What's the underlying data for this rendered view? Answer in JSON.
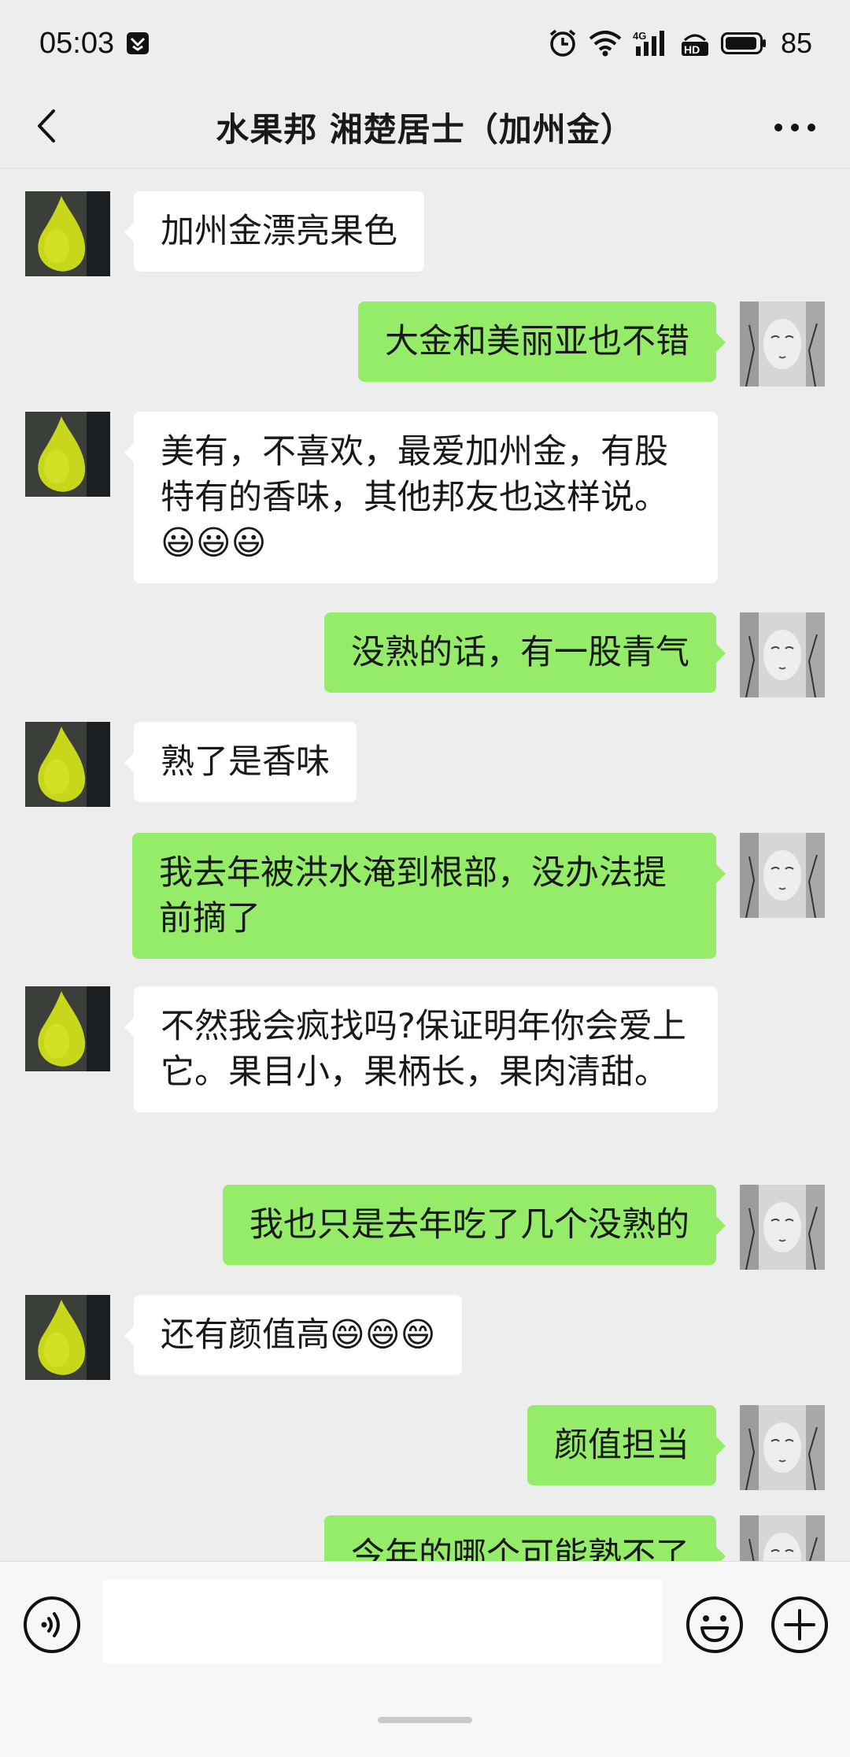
{
  "status_bar": {
    "time": "05:03",
    "battery": "85",
    "icons": [
      "app-notification-icon",
      "alarm-icon",
      "wifi-icon",
      "4g-signal-icon",
      "hd-icon",
      "battery-icon"
    ]
  },
  "header": {
    "title": "水果邦  湘楚居士（加州金）",
    "back_icon": "chevron-left-icon",
    "more_icon": "more-dots-icon"
  },
  "messages": [
    {
      "side": "left",
      "text": "加州金漂亮果色"
    },
    {
      "side": "right",
      "text": "大金和美丽亚也不错"
    },
    {
      "side": "left",
      "text": "美有，不喜欢，最爱加州金，有股特有的香味，其他邦友也这样说。😃😃😃"
    },
    {
      "side": "right",
      "text": "没熟的话，有一股青气"
    },
    {
      "side": "left",
      "text": "熟了是香味"
    },
    {
      "side": "right",
      "text": "我去年被洪水淹到根部，没办法提前摘了"
    },
    {
      "side": "left",
      "text": "不然我会疯找吗?保证明年你会爱上它。果目小，果柄长，果肉清甜。"
    },
    {
      "side": "right",
      "text": "我也只是去年吃了几个没熟的"
    },
    {
      "side": "left",
      "text": "还有颜值高😄😄😄"
    },
    {
      "side": "right",
      "text": "颜值担当"
    },
    {
      "side": "right",
      "text": "今年的哪个可能熟不了"
    }
  ],
  "input_bar": {
    "voice_icon": "voice-icon",
    "emoji_icon": "emoji-icon",
    "plus_icon": "plus-icon",
    "input_value": ""
  },
  "colors": {
    "background": "#ededed",
    "bubble_self": "#95ec69",
    "bubble_other": "#ffffff",
    "input_bar": "#f7f7f7"
  }
}
